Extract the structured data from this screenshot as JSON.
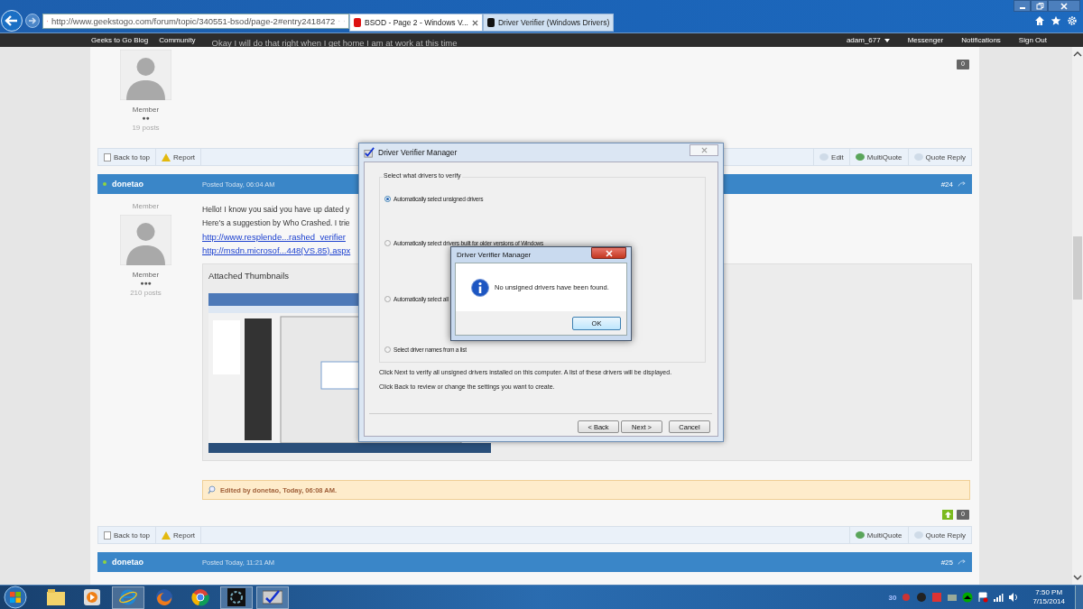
{
  "browser": {
    "address": "http://www.geekstogo.com/forum/topic/340551-bsod/page-2#entry2418472",
    "tabs": [
      {
        "title": "BSOD - Page 2 - Windows V...",
        "selected": true
      },
      {
        "title": "Driver Verifier (Windows Drivers)",
        "selected": false
      }
    ]
  },
  "site_nav": {
    "left": [
      "Geeks to Go Blog",
      "Community"
    ],
    "user": "adam_677",
    "right": [
      "Messenger",
      "Notifications",
      "Sign Out"
    ]
  },
  "background_text": "Okay I will do that right when I get home I am at work at this time",
  "previous_post": {
    "role": "Member",
    "rank": "●●",
    "posts": "19 posts",
    "reputation": "0",
    "controls_left": [
      "Back to top",
      "Report"
    ],
    "controls_right": [
      "Edit",
      "MultiQuote",
      "Quote Reply"
    ]
  },
  "post": {
    "author": "donetao",
    "online": true,
    "posted": "Posted Today, 06:04 AM",
    "number": "#24",
    "title_role": "Member",
    "role": "Member",
    "rank": "●●●",
    "posts": "210 posts",
    "lines": [
      "Hello! I know you said you have up dated y",
      "Here's a suggestion by Who Crashed. I trie"
    ],
    "links": [
      "http://www.resplende...rashed_verifier",
      "http://msdn.microsof...448(VS.85).aspx"
    ],
    "attachments_title": "Attached Thumbnails",
    "edited": "Edited by donetao, Today, 06:08 AM.",
    "reputation": "0",
    "controls_left": [
      "Back to top",
      "Report"
    ],
    "controls_right": [
      "MultiQuote",
      "Quote Reply"
    ]
  },
  "next_post": {
    "author": "donetao",
    "online": true,
    "posted": "Posted Today, 11:21 AM",
    "number": "#25"
  },
  "dialog": {
    "title": "Driver Verifier Manager",
    "group": "Select what drivers to verify",
    "options": [
      {
        "label": "Automatically select unsigned drivers",
        "selected": true
      },
      {
        "label": "Automatically select drivers built for older versions of Windows",
        "selected": false
      },
      {
        "label": "Automatically select all",
        "selected": false
      },
      {
        "label": "Select driver names from a list",
        "selected": false
      }
    ],
    "notes": [
      "Click Next to verify all unsigned drivers installed on this computer. A list of these drivers will be displayed.",
      "Click Back to review or change the settings you want to create."
    ],
    "buttons": [
      "< Back",
      "Next >",
      "Cancel"
    ]
  },
  "message_box": {
    "title": "Driver Verifier Manager",
    "message": "No unsigned drivers have been found.",
    "button": "OK"
  },
  "taskbar": {
    "tray_text": "30",
    "time": "7:50 PM",
    "date": "7/15/2014"
  }
}
